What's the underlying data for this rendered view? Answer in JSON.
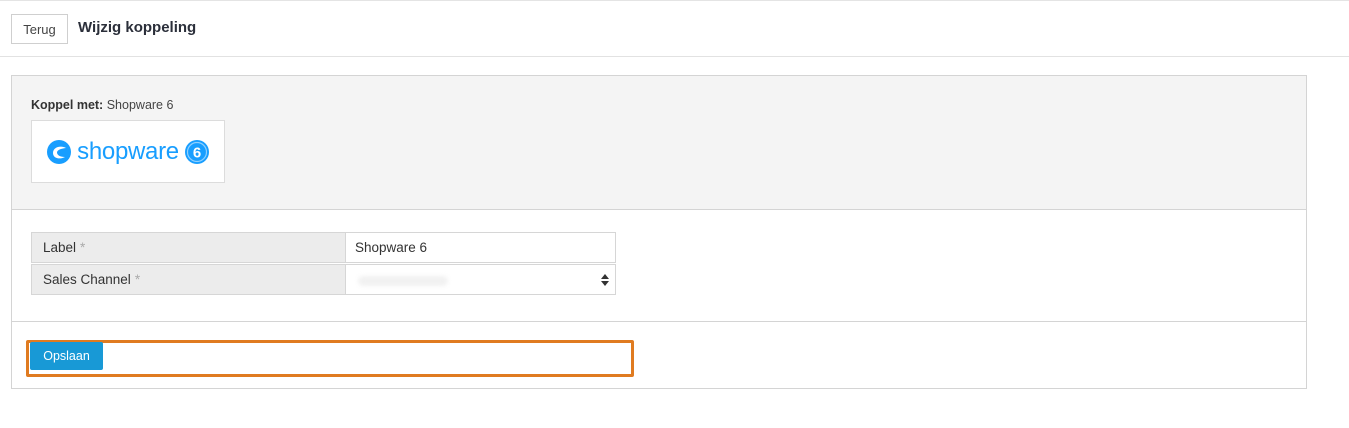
{
  "header": {
    "back_label": "Terug",
    "title": "Wijzig koppeling"
  },
  "connection": {
    "koppel_label": "Koppel met:",
    "koppel_value": "Shopware 6",
    "logo_text": "shopware",
    "logo_badge": "6"
  },
  "form": {
    "label_field": {
      "label": "Label",
      "required_mark": "*",
      "value": "Shopware 6"
    },
    "sales_channel_field": {
      "label": "Sales Channel",
      "required_mark": "*",
      "value": ""
    }
  },
  "actions": {
    "save_label": "Opslaan"
  },
  "colors": {
    "accent": "#1899d6",
    "highlight": "#e07b20",
    "logo": "#189eff"
  }
}
